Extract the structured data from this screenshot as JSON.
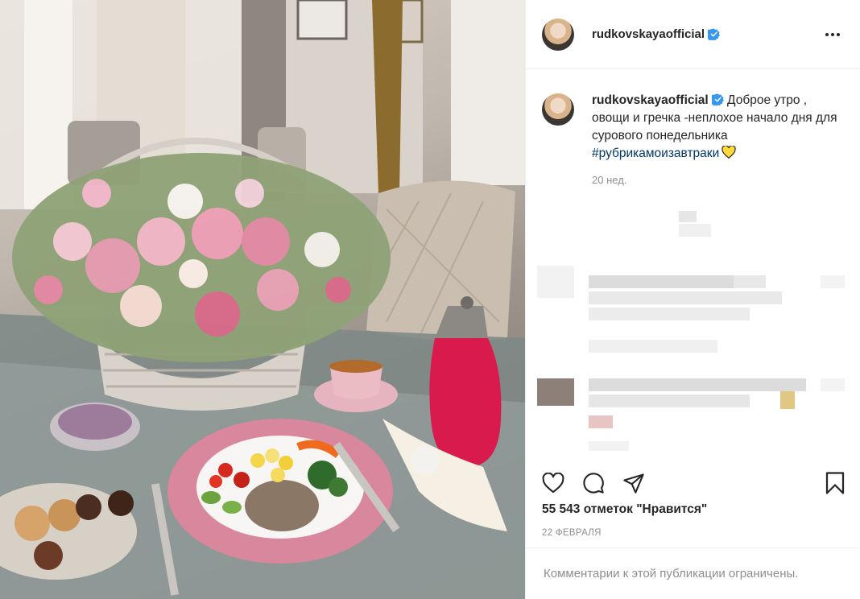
{
  "post": {
    "username": "rudkovskayaofficial",
    "more_icon": "more-horizontal-icon",
    "verified_icon": "verified-badge-icon"
  },
  "caption": {
    "username": "rudkovskayaofficial",
    "text": "Доброе утро , овощи и гречка -неплохое начало дня для сурового понедельника",
    "hashtag": "#рубрикамоизавтраки",
    "emoji": "yellow-heart",
    "time_ago": "20 нед."
  },
  "actions": {
    "like_icon": "heart-icon",
    "comment_icon": "comment-icon",
    "share_icon": "share-icon",
    "save_icon": "bookmark-icon"
  },
  "likes_text": "55 543 отметок \"Нравится\"",
  "date_text": "22 ФЕВРАЛЯ",
  "comments_restricted": "Комментарии к этой публикации ограничены.",
  "colors": {
    "link": "#00376b",
    "muted": "#8e8e8e",
    "text": "#262626",
    "verified": "#3897f0",
    "border": "#efefef"
  }
}
